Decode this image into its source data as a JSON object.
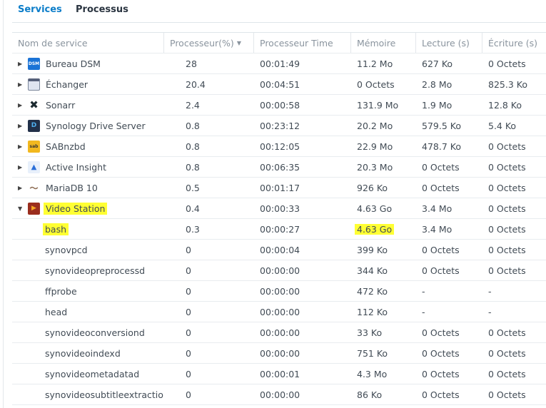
{
  "tabs": [
    {
      "label": "Services",
      "active": true
    },
    {
      "label": "Processus",
      "active": false
    }
  ],
  "columns": [
    "Nom de service",
    "Processeur(%)",
    "Processeur Time",
    "Mémoire",
    "Lecture (s)",
    "Écriture (s)"
  ],
  "rows": [
    {
      "name": "Bureau DSM",
      "cpu": "28",
      "time": "00:01:49",
      "mem": "11.2 Mo",
      "read": "627 Ko",
      "write": "0 Octets",
      "icon": "dsm-icon",
      "level": 0,
      "expanded": false
    },
    {
      "name": "Échanger",
      "cpu": "20.4",
      "time": "00:04:51",
      "mem": "0 Octets",
      "read": "2.8 Mo",
      "write": "825.3 Ko",
      "icon": "window-icon",
      "level": 0,
      "expanded": false
    },
    {
      "name": "Sonarr",
      "cpu": "2.4",
      "time": "00:00:58",
      "mem": "131.9 Mo",
      "read": "1.9 Mo",
      "write": "12.8 Ko",
      "icon": "sonarr-icon",
      "level": 0,
      "expanded": false
    },
    {
      "name": "Synology Drive Server",
      "cpu": "0.8",
      "time": "00:23:12",
      "mem": "20.2 Mo",
      "read": "579.5 Ko",
      "write": "5.4 Ko",
      "icon": "drive-icon",
      "level": 0,
      "expanded": false
    },
    {
      "name": "SABnzbd",
      "cpu": "0.8",
      "time": "00:12:05",
      "mem": "22.9 Mo",
      "read": "478.7 Ko",
      "write": "0 Octets",
      "icon": "sabnzbd-icon",
      "level": 0,
      "expanded": false
    },
    {
      "name": "Active Insight",
      "cpu": "0.8",
      "time": "00:06:35",
      "mem": "20.3 Mo",
      "read": "0 Octets",
      "write": "0 Octets",
      "icon": "active-insight-icon",
      "level": 0,
      "expanded": false
    },
    {
      "name": "MariaDB 10",
      "cpu": "0.5",
      "time": "00:01:17",
      "mem": "926 Ko",
      "read": "0 Octets",
      "write": "0 Octets",
      "icon": "mariadb-icon",
      "level": 0,
      "expanded": false
    },
    {
      "name": "Video Station",
      "cpu": "0.4",
      "time": "00:00:33",
      "mem": "4.63 Go",
      "read": "3.4 Mo",
      "write": "0 Octets",
      "icon": "video-station-icon",
      "level": 0,
      "expanded": true,
      "highlight_name": true
    },
    {
      "name": "bash",
      "cpu": "0.3",
      "time": "00:00:27",
      "mem": "4.63 Go",
      "read": "3.4 Mo",
      "write": "0 Octets",
      "level": 1,
      "highlight_name": true,
      "highlight_mem": true
    },
    {
      "name": "synovpcd",
      "cpu": "0",
      "time": "00:00:04",
      "mem": "399 Ko",
      "read": "0 Octets",
      "write": "0 Octets",
      "level": 1
    },
    {
      "name": "synovideopreprocessd",
      "cpu": "0",
      "time": "00:00:00",
      "mem": "344 Ko",
      "read": "0 Octets",
      "write": "0 Octets",
      "level": 1
    },
    {
      "name": "ffprobe",
      "cpu": "0",
      "time": "00:00:00",
      "mem": "472 Ko",
      "read": "-",
      "write": "-",
      "level": 1
    },
    {
      "name": "head",
      "cpu": "0",
      "time": "00:00:00",
      "mem": "112 Ko",
      "read": "-",
      "write": "-",
      "level": 1
    },
    {
      "name": "synovideoconversiond",
      "cpu": "0",
      "time": "00:00:00",
      "mem": "33 Ko",
      "read": "0 Octets",
      "write": "0 Octets",
      "level": 1
    },
    {
      "name": "synovideoindexd",
      "cpu": "0",
      "time": "00:00:00",
      "mem": "751 Ko",
      "read": "0 Octets",
      "write": "0 Octets",
      "level": 1
    },
    {
      "name": "synovideometadatad",
      "cpu": "0",
      "time": "00:00:01",
      "mem": "4.3 Mo",
      "read": "0 Octets",
      "write": "0 Octets",
      "level": 1
    },
    {
      "name": "synovideosubtitleextraction",
      "cpu": "0",
      "time": "00:00:00",
      "mem": "86 Ko",
      "read": "0 Octets",
      "write": "0 Octets",
      "level": 1
    }
  ]
}
